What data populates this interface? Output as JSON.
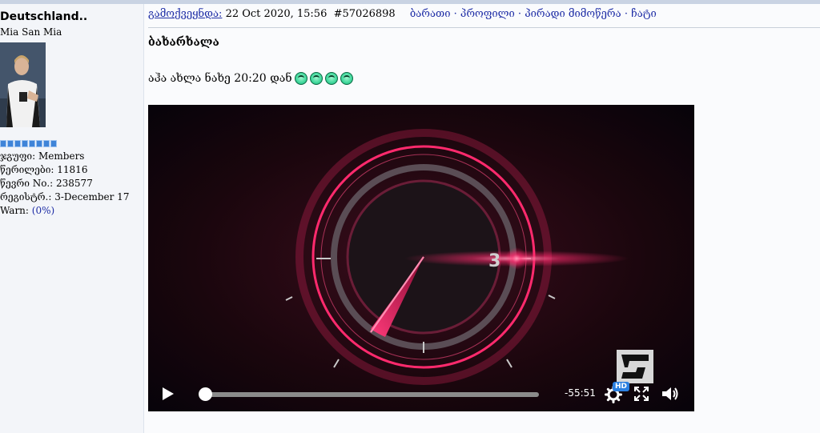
{
  "user": {
    "name": "Deutschland..",
    "title": "Mia San Mia",
    "rank_pips": 8,
    "info": [
      {
        "label": "ჯგუფი:",
        "value": "Members"
      },
      {
        "label": "წერილები:",
        "value": "11816"
      },
      {
        "label": "წევრი No.:",
        "value": "238577"
      },
      {
        "label": "რეგისტრ.:",
        "value": "3-December 17"
      }
    ],
    "warn_label": "Warn:",
    "warn_value": "(0%)"
  },
  "post": {
    "published_label": "გამოქვეყნდა:",
    "date": "22 Oct 2020, 15:56",
    "post_number": "#57026898",
    "links": [
      "ბარათი",
      "პროფილი",
      "პირადი მიმოწერა",
      "ჩატი"
    ],
    "link_separator": "·",
    "title": "ბახარხალა",
    "body": "აჰა ახლა ნახე 20:20 დან",
    "smiley_count": 4
  },
  "video": {
    "countdown_number": "3",
    "time_remaining": "-55:51",
    "hd_badge": "HD",
    "progress": 0.0,
    "icons": [
      "play-icon",
      "settings-gear-icon",
      "fullscreen-icon",
      "volume-icon"
    ],
    "colors": {
      "accent": "#ff2a6d",
      "background": "#0b0508"
    }
  }
}
